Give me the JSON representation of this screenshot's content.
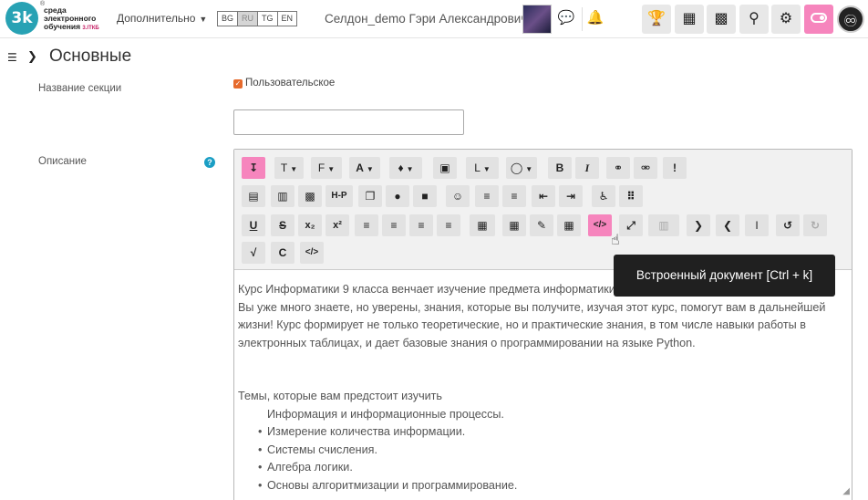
{
  "header": {
    "logo_text": "3k",
    "logo_reg": "®",
    "logo_lines": [
      "среда",
      "электронного",
      "обучения"
    ],
    "logo_sub": "3.IТКБ",
    "more_menu": "Дополнительно",
    "languages": [
      {
        "code": "BG",
        "active": false
      },
      {
        "code": "RU",
        "active": true
      },
      {
        "code": "TG",
        "active": false
      },
      {
        "code": "EN",
        "active": false
      }
    ],
    "username": "Селдон_demo Гэри Александрович",
    "icons": [
      "chat-icon",
      "bell-icon"
    ],
    "buttons": [
      "trophy-icon",
      "grid-icon",
      "dashboard-icon",
      "search-icon",
      "gear-icon",
      "toggle-icon",
      "accessibility-icon"
    ]
  },
  "section": {
    "title": "Основные",
    "name_label": "Название секции",
    "custom_label": "Пользовательское",
    "custom_checked": true,
    "name_value": "",
    "description_label": "Описание"
  },
  "editor": {
    "tooltip": "Встроенный документ [Ctrl + k]",
    "paragraph": "Курс Информатики 9 класса венчает изучение предмета информатики, который вы осваивали с пятого класса. Вы уже много знаете, но уверены, знания, которые вы получите, изучая этот курс, помогут вам в дальнейшей жизни! Курс формирует не только теоретические, но и практические знания, в том числе навыки работы в электронных таблицах, и дает базовые знания о программировании на языке Python.",
    "topics_heading": "Темы, которые вам предстоит изучить",
    "topics_first": "Информация и информационные процессы.",
    "topics": [
      "Измерение количества информации.",
      "Системы счисления.",
      "Алгебра логики.",
      "Основы алгоритмизации и программирование."
    ]
  }
}
